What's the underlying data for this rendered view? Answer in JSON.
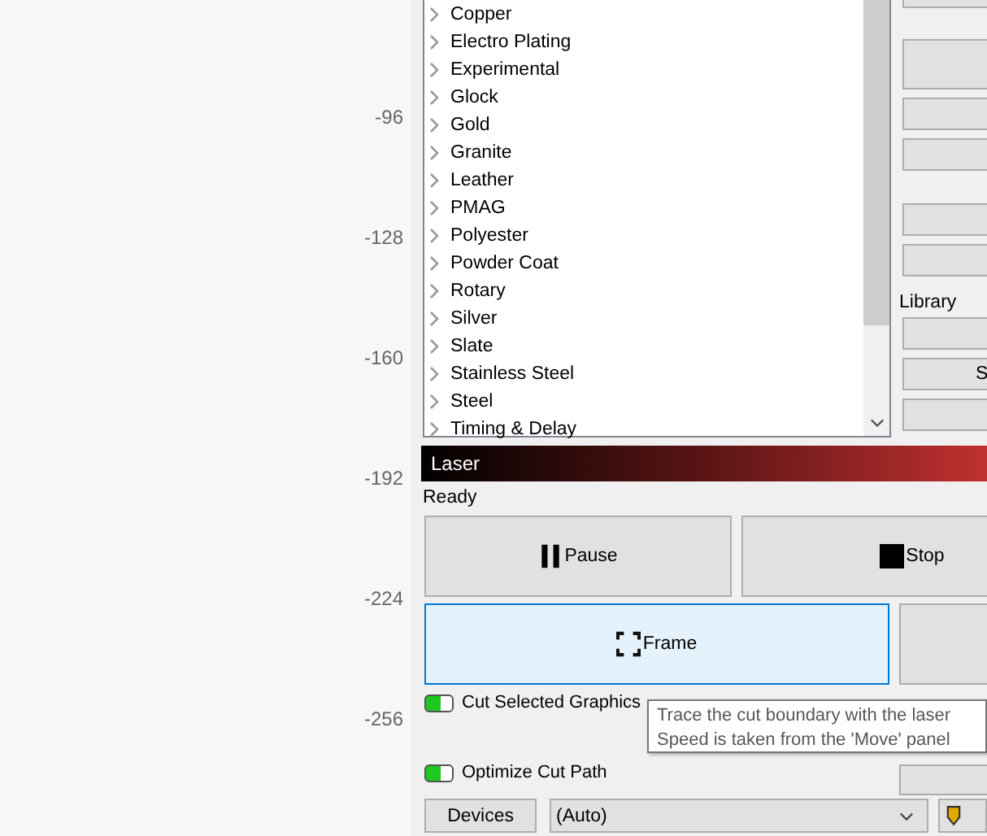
{
  "ruler": {
    "labels": [
      "-96",
      "-128",
      "-160",
      "-192",
      "-224",
      "-256"
    ]
  },
  "library_tree": {
    "items": [
      {
        "label": "Copper",
        "expanded": false
      },
      {
        "label": "Electro Plating",
        "expanded": false
      },
      {
        "label": "Experimental",
        "expanded": false
      },
      {
        "label": "Glock",
        "expanded": false
      },
      {
        "label": "Gold",
        "expanded": false
      },
      {
        "label": "Granite",
        "expanded": false
      },
      {
        "label": "Leather",
        "expanded": false
      },
      {
        "label": "PMAG",
        "expanded": false
      },
      {
        "label": "Polyester",
        "expanded": false
      },
      {
        "label": "Powder Coat",
        "expanded": false
      },
      {
        "label": "Rotary",
        "expanded": false
      },
      {
        "label": "Silver",
        "expanded": false
      },
      {
        "label": "Slate",
        "expanded": false
      },
      {
        "label": "Stainless Steel",
        "expanded": false
      },
      {
        "label": "Steel",
        "expanded": false
      },
      {
        "label": "Timing & Delay",
        "expanded": false
      }
    ]
  },
  "side_panel": {
    "group_label": "Library",
    "button_text": "S"
  },
  "laser": {
    "title": "Laser",
    "status": "Ready",
    "buttons": [
      {
        "label": "Pause",
        "kind": "pause",
        "selected": false
      },
      {
        "label": "Stop",
        "kind": "stop",
        "selected": false
      },
      {
        "label": "Frame",
        "kind": "frame",
        "selected": true
      }
    ],
    "toggles": [
      {
        "label": "Cut Selected Graphics",
        "on": true
      },
      {
        "label": "Optimize Cut Path",
        "on": true
      }
    ],
    "tooltip": [
      "Trace the cut boundary with the laser",
      "Speed is taken from the 'Move' panel"
    ],
    "devices_button": "Devices",
    "device_select": {
      "value": "(Auto)"
    }
  }
}
